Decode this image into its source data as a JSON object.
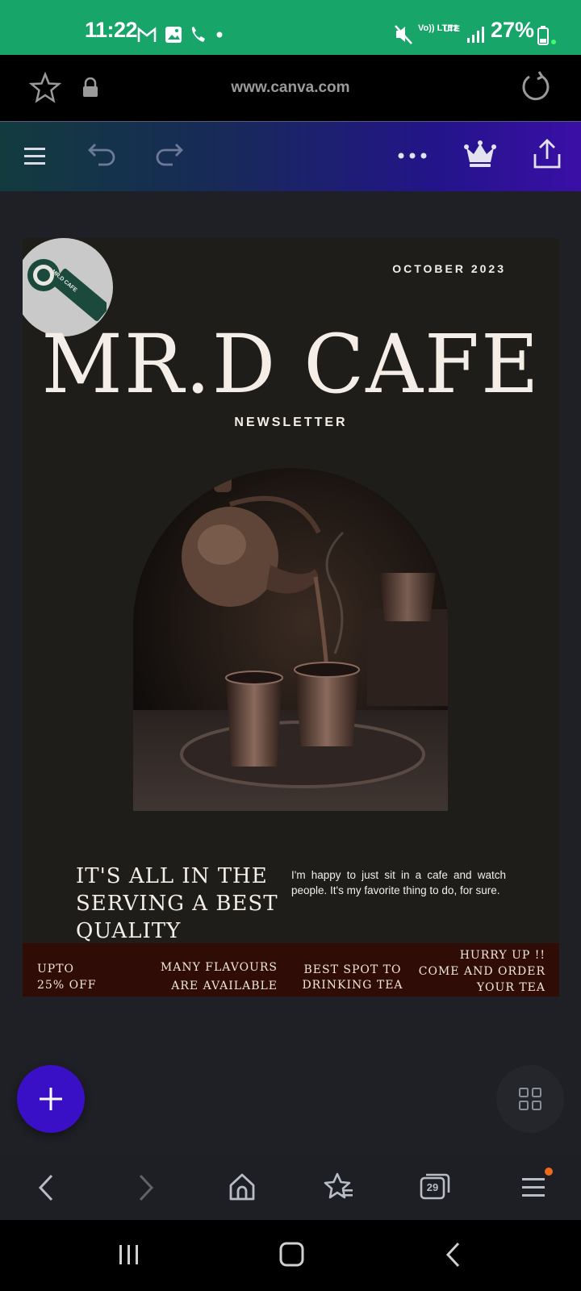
{
  "status_bar": {
    "time": "11:22",
    "battery": "27%",
    "network_volte": "Vo)) LTE2",
    "network_lte": "LTE"
  },
  "browser": {
    "url": "www.canva.com"
  },
  "newsletter": {
    "date": "OCTOBER 2023",
    "title": "MR.D CAFE",
    "subtitle": "NEWSLETTER",
    "logo_text": "MR.D CAFE",
    "heading": "IT'S ALL IN THE SERVING A BEST QUALITY",
    "body": "I'm happy to just sit in a cafe and watch people. It's my favorite thing to do, for sure.",
    "banner": {
      "offer_line1": "UPTO",
      "offer_line2": "25% OFF",
      "flavours_line1": "MANY FLAVOURS",
      "flavours_line2": "ARE AVAILABLE",
      "spot_line1": "BEST SPOT TO",
      "spot_line2": "DRINKING TEA",
      "hurry_line1": "HURRY UP !!",
      "hurry_line2": "COME AND ORDER",
      "hurry_line3": "YOUR TEA"
    }
  },
  "bottom_nav": {
    "tabs_count": "29"
  },
  "colors": {
    "status_bar": "#17a56a",
    "page_bg": "#1f1d1a",
    "banner_bg": "#300c06",
    "fab_add": "#3a10c7"
  }
}
